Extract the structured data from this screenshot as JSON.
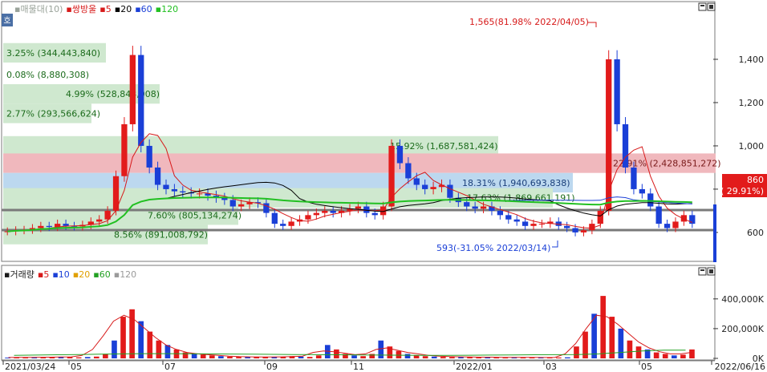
{
  "price_panel": {
    "legend": [
      {
        "label": "매물대(10)",
        "color": "#9aa39a"
      },
      {
        "label": "쌍방울",
        "color": "#d71a1a"
      },
      {
        "label": "5",
        "color": "#d71a1a"
      },
      {
        "label": "20",
        "color": "#000000"
      },
      {
        "label": "60",
        "color": "#1a3fd7"
      },
      {
        "label": "120",
        "color": "#22c022"
      }
    ],
    "corner_button": "호",
    "current_price_tag": {
      "price": "860",
      "change": "( 29.91%)",
      "bg": "#e21b1b"
    },
    "high_annotation": "1,565(81.98% 2022/04/05)",
    "low_annotation": "593(-31.05% 2022/03/14)",
    "y_ticks": [
      "1,400",
      "1,200",
      "1,000",
      "800",
      "600"
    ]
  },
  "volume_profile": [
    {
      "label": "3.25% (344,443,840)",
      "color": "#cfe8cf"
    },
    {
      "label": "0.08% (8,880,308)",
      "color": "#cfe8cf"
    },
    {
      "label": "4.99% (528,843,008)",
      "color": "#cfe8cf"
    },
    {
      "label": "2.77% (293,566,624)",
      "color": "#cfe8cf"
    },
    {
      "label": "15.92% (1,687,581,424)",
      "color": "#cfe8cf"
    },
    {
      "label": "22.91% (2,428,851,272)",
      "color": "#f0b8bd"
    },
    {
      "label": "18.31% (1,940,693,838)",
      "color": "#bcd8ef"
    },
    {
      "label": "17.63% (1,869,661,191)",
      "color": "#cfe8cf"
    },
    {
      "label": "7.60% (805,134,274)",
      "color": "#cfe8cf"
    },
    {
      "label": "8.56% (891,008,792)",
      "color": "#cfe8cf"
    }
  ],
  "volume_panel": {
    "legend": [
      {
        "label": "거래량",
        "color": "#1a1a1a"
      },
      {
        "label": "5",
        "color": "#d71a1a"
      },
      {
        "label": "10",
        "color": "#1a3fd7"
      },
      {
        "label": "20",
        "color": "#e0a000"
      },
      {
        "label": "60",
        "color": "#22a022"
      },
      {
        "label": "120",
        "color": "#9a9a9a"
      }
    ],
    "y_ticks": [
      "400,000K",
      "200,000K",
      "0K"
    ]
  },
  "x_axis": {
    "labels": [
      "2021/03/24",
      "05",
      "07",
      "09",
      "11",
      "2022/01",
      "03",
      "05",
      "2022/06/16"
    ]
  },
  "chart_data": {
    "type": "candlestick",
    "ylim": [
      470,
      1600
    ],
    "volume_ylim": [
      0,
      550000
    ],
    "price_series": [
      605,
      610,
      612,
      620,
      630,
      625,
      640,
      630,
      628,
      635,
      650,
      660,
      700,
      860,
      1100,
      1420,
      1000,
      900,
      820,
      800,
      790,
      785,
      780,
      780,
      770,
      760,
      750,
      720,
      730,
      740,
      735,
      690,
      640,
      630,
      650,
      660,
      680,
      690,
      700,
      690,
      700,
      710,
      720,
      690,
      680,
      720,
      1000,
      920,
      850,
      820,
      800,
      810,
      820,
      760,
      740,
      720,
      710,
      720,
      700,
      680,
      660,
      650,
      630,
      640,
      640,
      650,
      630,
      620,
      600,
      610,
      640,
      700,
      1400,
      1100,
      900,
      800,
      780,
      720,
      640,
      620,
      650,
      680,
      640
    ],
    "volume_series": [
      5000,
      6000,
      8000,
      6000,
      7000,
      9000,
      10000,
      8000,
      7000,
      9000,
      12000,
      30000,
      120000,
      280000,
      330000,
      250000,
      180000,
      120000,
      90000,
      60000,
      40000,
      30000,
      25000,
      20000,
      15000,
      12000,
      10000,
      8000,
      9000,
      10000,
      8000,
      9000,
      15000,
      12000,
      10000,
      20000,
      90000,
      60000,
      30000,
      20000,
      15000,
      30000,
      120000,
      80000,
      50000,
      30000,
      20000,
      15000,
      12000,
      10000,
      9000,
      8000,
      8000,
      6000,
      7000,
      8000,
      6000,
      7000,
      6000,
      8000,
      6000,
      5000,
      6000,
      7000,
      80000,
      180000,
      300000,
      420000,
      280000,
      200000,
      120000,
      80000,
      60000,
      40000,
      30000,
      20000,
      25000,
      60000
    ],
    "ma5_volume": [
      6000,
      6500,
      7000,
      7500,
      8000,
      9000,
      10000,
      20000,
      60000,
      150000,
      250000,
      290000,
      260000,
      200000,
      140000,
      90000,
      60000,
      40000,
      30000,
      25000,
      20000,
      15000,
      12000,
      10000,
      9000,
      9000,
      10000,
      12000,
      15000,
      40000,
      50000,
      45000,
      35000,
      25000,
      30000,
      60000,
      70000,
      55000,
      40000,
      30000,
      20000,
      15000,
      12000,
      10000,
      9000,
      8000,
      8000,
      7000,
      7000,
      7000,
      7000,
      6000,
      6000,
      30000,
      100000,
      200000,
      290000,
      280000,
      230000,
      170000,
      110000,
      70000,
      45000,
      30000,
      30000,
      40000
    ],
    "ma60_volume": [
      20000,
      22000,
      24000,
      26000,
      28000,
      30000,
      32000,
      32000,
      31000,
      30000,
      29000,
      28000,
      27000,
      26000,
      25000,
      24000,
      23000,
      22000,
      21000,
      20000,
      20000,
      21000,
      22000,
      23000,
      24000,
      25000,
      26000,
      30000,
      40000,
      50000,
      55000,
      55000
    ],
    "annotations": [
      "1,565(81.98% 2022/04/05)",
      "593(-31.05% 2022/03/14)"
    ]
  }
}
